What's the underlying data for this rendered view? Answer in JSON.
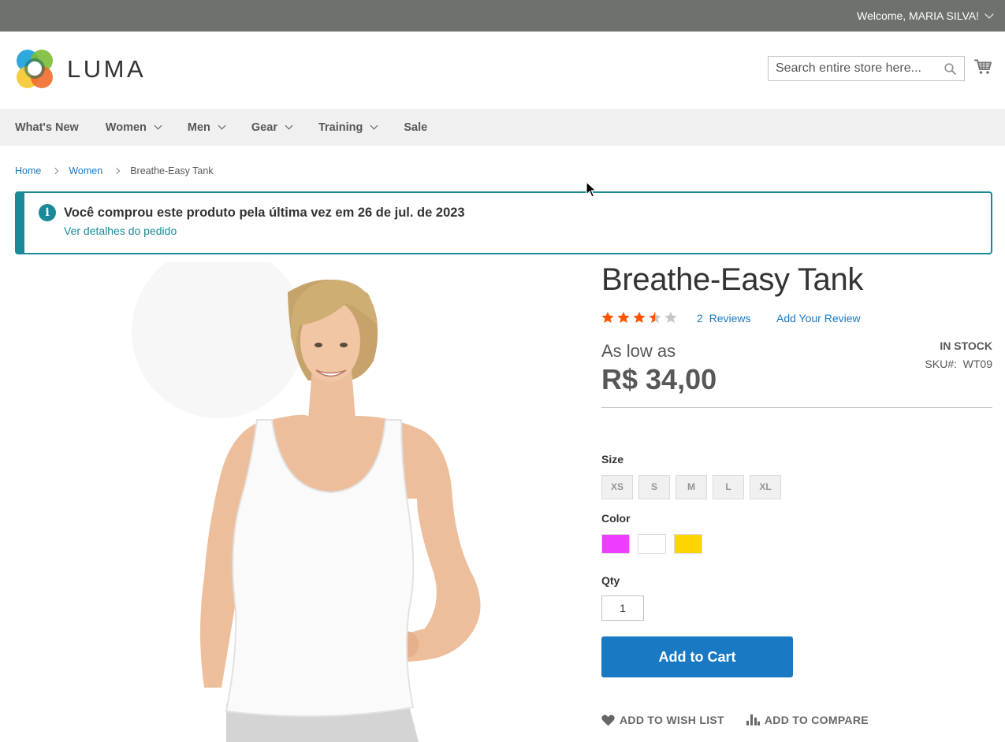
{
  "header": {
    "welcome": "Welcome, MARIA SILVA!",
    "logo_text": "LUMA",
    "search_placeholder": "Search entire store here..."
  },
  "nav": [
    "What's New",
    "Women",
    "Men",
    "Gear",
    "Training",
    "Sale"
  ],
  "breadcrumb": {
    "home": "Home",
    "category": "Women",
    "current": "Breathe-Easy Tank"
  },
  "notice": {
    "icon": "i",
    "message": "Você comprou este produto pela última vez em 26 de jul. de 2023",
    "link": "Ver detalhes do pedido"
  },
  "product": {
    "name": "Breathe-Easy Tank",
    "rating_fraction": 0.7,
    "reviews_count": "2",
    "reviews_label": "Reviews",
    "add_review": "Add Your Review",
    "as_low_as": "As low as",
    "price": "R$ 34,00",
    "stock": "IN STOCK",
    "sku_label": "SKU#:",
    "sku": "WT09",
    "size_label": "Size",
    "sizes": [
      "XS",
      "S",
      "M",
      "L",
      "XL"
    ],
    "color_label": "Color",
    "colors": [
      "#ef3dff",
      "#ffffff",
      "#ffd500"
    ],
    "qty_label": "Qty",
    "qty": "1",
    "add_to_cart": "Add to Cart",
    "wish_list": "ADD TO WISH LIST",
    "compare": "ADD TO COMPARE"
  },
  "colors": {
    "accent": "#1979c3",
    "notice": "#1a8a98",
    "star": "#ff5501",
    "topbar": "#6e716e"
  }
}
